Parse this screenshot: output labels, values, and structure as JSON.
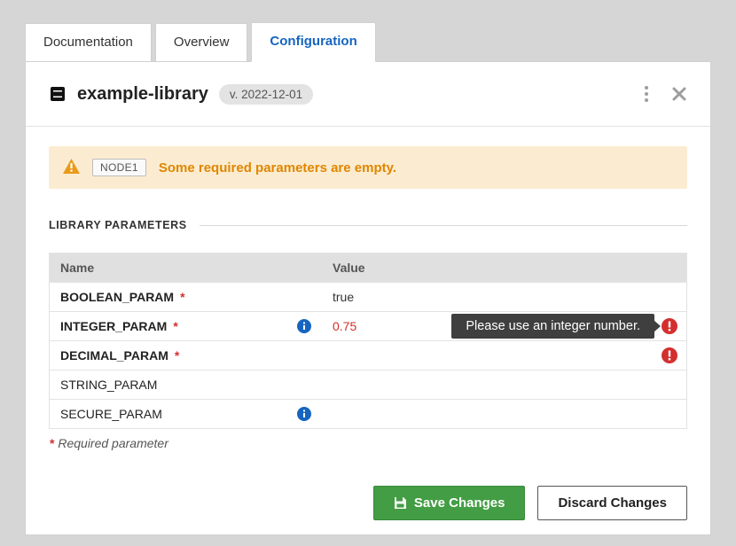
{
  "tabs": {
    "documentation": "Documentation",
    "overview": "Overview",
    "configuration": "Configuration"
  },
  "header": {
    "title": "example-library",
    "version": "v. 2022-12-01"
  },
  "alert": {
    "node": "NODE1",
    "message": "Some required parameters are empty."
  },
  "section": {
    "title": "LIBRARY PARAMETERS"
  },
  "table": {
    "col_name": "Name",
    "col_value": "Value",
    "rows": [
      {
        "name": "BOOLEAN_PARAM",
        "required": true,
        "info": false,
        "value": "true",
        "value_error": false,
        "tooltip": "",
        "err_icon": false,
        "plain": false
      },
      {
        "name": "INTEGER_PARAM",
        "required": true,
        "info": true,
        "value": "0.75",
        "value_error": true,
        "tooltip": "Please use an integer number.",
        "err_icon": true,
        "plain": false
      },
      {
        "name": "DECIMAL_PARAM",
        "required": true,
        "info": false,
        "value": "",
        "value_error": false,
        "tooltip": "",
        "err_icon": true,
        "plain": false
      },
      {
        "name": "STRING_PARAM",
        "required": false,
        "info": false,
        "value": "",
        "value_error": false,
        "tooltip": "",
        "err_icon": false,
        "plain": true
      },
      {
        "name": "SECURE_PARAM",
        "required": false,
        "info": true,
        "value": "",
        "value_error": false,
        "tooltip": "",
        "err_icon": false,
        "plain": true
      }
    ],
    "required_note": "Required parameter"
  },
  "footer": {
    "save": "Save Changes",
    "discard": "Discard Changes"
  }
}
